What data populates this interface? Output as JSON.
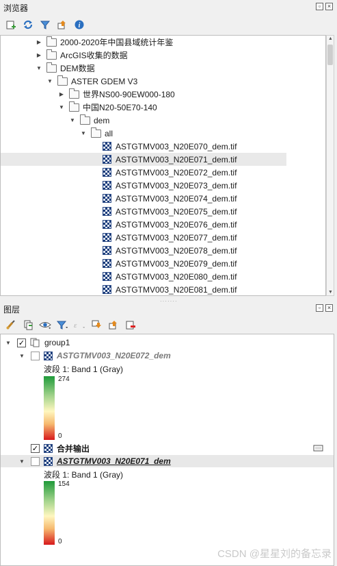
{
  "browser": {
    "title": "浏览器",
    "items": [
      {
        "label": "2000-2020年中国县域统计年鉴"
      },
      {
        "label": "ArcGIS收集的数据"
      },
      {
        "label": "DEM数据"
      },
      {
        "label": "ASTER GDEM V3"
      },
      {
        "label": "世界NS00-90EW000-180"
      },
      {
        "label": "中国N20-50E70-140"
      },
      {
        "label": "dem"
      },
      {
        "label": "all"
      },
      {
        "label": "ASTGTMV003_N20E070_dem.tif"
      },
      {
        "label": "ASTGTMV003_N20E071_dem.tif"
      },
      {
        "label": "ASTGTMV003_N20E072_dem.tif"
      },
      {
        "label": "ASTGTMV003_N20E073_dem.tif"
      },
      {
        "label": "ASTGTMV003_N20E074_dem.tif"
      },
      {
        "label": "ASTGTMV003_N20E075_dem.tif"
      },
      {
        "label": "ASTGTMV003_N20E076_dem.tif"
      },
      {
        "label": "ASTGTMV003_N20E077_dem.tif"
      },
      {
        "label": "ASTGTMV003_N20E078_dem.tif"
      },
      {
        "label": "ASTGTMV003_N20E079_dem.tif"
      },
      {
        "label": "ASTGTMV003_N20E080_dem.tif"
      },
      {
        "label": "ASTGTMV003_N20E081_dem.tif"
      }
    ]
  },
  "layers": {
    "title": "图层",
    "group_label": "group1",
    "layer1": {
      "name": "ASTGTMV003_N20E072_dem",
      "band": "波段 1: Band 1 (Gray)",
      "max": "274",
      "min": "0"
    },
    "merged": {
      "name": "合并输出"
    },
    "layer2": {
      "name": "ASTGTMV003_N20E071_dem",
      "band": "波段 1: Band 1 (Gray)",
      "max": "154",
      "min": "0"
    }
  },
  "watermark": "CSDN @星星刘的备忘录",
  "colors": {
    "ramp_top": "#1f9a3a",
    "ramp_bottom": "#d7191c",
    "selection": "#e9e9e9"
  }
}
